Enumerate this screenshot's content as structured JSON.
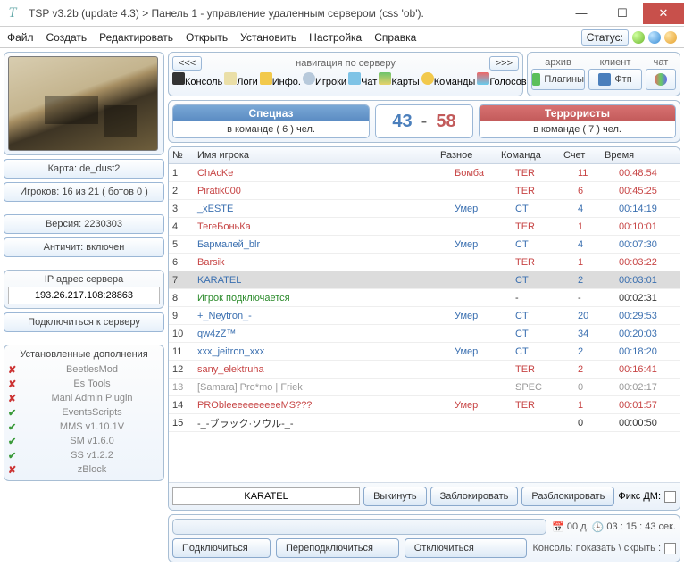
{
  "window": {
    "title": "TSP v3.2b (update 4.3) > Панель 1 - управление удаленным сервером (css 'ob')."
  },
  "menu": {
    "file": "Файл",
    "create": "Создать",
    "edit": "Редактировать",
    "open": "Открыть",
    "install": "Установить",
    "settings": "Настройка",
    "help": "Справка",
    "status_label": "Статус:"
  },
  "nav": {
    "title": "навигация по серверу",
    "prev": "<<<",
    "next": ">>>",
    "items": {
      "console": "Консоль",
      "logs": "Логи",
      "info": "Инфо.",
      "players": "Игроки",
      "chat": "Чат",
      "maps": "Карты",
      "teams": "Команды",
      "voting": "Голосование"
    }
  },
  "topright": {
    "archive": {
      "head": "архив",
      "label": "Плагины"
    },
    "client": {
      "head": "клиент",
      "label": "Фтп"
    },
    "chat": {
      "head": "чат",
      "label": ""
    }
  },
  "left": {
    "map_label": "Карта: de_dust2",
    "players_label": "Игроков: 16 из 21 ( ботов 0 )",
    "version_label": "Версия: 2230303",
    "anticheat_label": "Античит: включен",
    "ip_head": "IP адрес сервера",
    "ip_value": "193.26.217.108:28863",
    "connect_btn": "Подключиться к серверу",
    "addons_head": "Установленные дополнения",
    "addons": [
      {
        "ok": false,
        "name": "BeetlesMod"
      },
      {
        "ok": false,
        "name": "Es Tools"
      },
      {
        "ok": false,
        "name": "Mani Admin Plugin"
      },
      {
        "ok": true,
        "name": "EventsScripts"
      },
      {
        "ok": true,
        "name": "MMS v1.10.1V"
      },
      {
        "ok": true,
        "name": "SM v1.6.0"
      },
      {
        "ok": true,
        "name": "SS v1.2.2"
      },
      {
        "ok": false,
        "name": "zBlock"
      }
    ]
  },
  "teams": {
    "ct": {
      "title": "Спецназ",
      "sub": "в команде ( 6 ) чел.",
      "score": "43"
    },
    "t": {
      "title": "Террористы",
      "sub": "в команде ( 7 ) чел.",
      "score": "58"
    },
    "dash": "-"
  },
  "table": {
    "headers": {
      "n": "№",
      "name": "Имя игрока",
      "misc": "Разное",
      "team": "Команда",
      "score": "Счет",
      "time": "Время"
    },
    "rows": [
      {
        "n": "1",
        "name": "ChAcKe",
        "misc": "Бомба",
        "team": "TER",
        "score": "11",
        "time": "00:48:54",
        "cls": "teamTER"
      },
      {
        "n": "2",
        "name": "Piratik000",
        "misc": "",
        "team": "TER",
        "score": "6",
        "time": "00:45:25",
        "cls": "teamTER"
      },
      {
        "n": "3",
        "name": "_xESTE",
        "misc": "Умер",
        "team": "CT",
        "score": "4",
        "time": "00:14:19",
        "cls": "teamCT"
      },
      {
        "n": "4",
        "name": "ТегеБоньКа",
        "misc": "",
        "team": "TER",
        "score": "1",
        "time": "00:10:01",
        "cls": "teamTER"
      },
      {
        "n": "5",
        "name": "Бармалей_blr",
        "misc": "Умер",
        "team": "CT",
        "score": "4",
        "time": "00:07:30",
        "cls": "teamCT"
      },
      {
        "n": "6",
        "name": "Barsik",
        "misc": "",
        "team": "TER",
        "score": "1",
        "time": "00:03:22",
        "cls": "teamTER"
      },
      {
        "n": "7",
        "name": "KARATEL",
        "misc": "",
        "team": "CT",
        "score": "2",
        "time": "00:03:01",
        "cls": "teamCT",
        "sel": true
      },
      {
        "n": "8",
        "name": "Игрок подключается",
        "misc": "",
        "team": "-",
        "score": "-",
        "time": "00:02:31",
        "cls": "teamNONE connecting"
      },
      {
        "n": "9",
        "name": "+_Neytron_-",
        "misc": "Умер",
        "team": "CT",
        "score": "20",
        "time": "00:29:53",
        "cls": "teamCT"
      },
      {
        "n": "10",
        "name": "qw4zZ™",
        "misc": "",
        "team": "CT",
        "score": "34",
        "time": "00:20:03",
        "cls": "teamCT"
      },
      {
        "n": "11",
        "name": "xxx_jeitron_xxx",
        "misc": "Умер",
        "team": "CT",
        "score": "2",
        "time": "00:18:20",
        "cls": "teamCT"
      },
      {
        "n": "12",
        "name": "sany_elektruha",
        "misc": "",
        "team": "TER",
        "score": "2",
        "time": "00:16:41",
        "cls": "teamTER"
      },
      {
        "n": "13",
        "name": "[Samara] Pro*mo | Friek",
        "misc": "",
        "team": "SPEC",
        "score": "0",
        "time": "00:02:17",
        "cls": "teamSPEC"
      },
      {
        "n": "14",
        "name": "PRObleeeeeeeeeeMS???",
        "misc": "Умер",
        "team": "TER",
        "score": "1",
        "time": "00:01:57",
        "cls": "teamTER"
      },
      {
        "n": "15",
        "name": "-_-ブラック·ソウル-_-",
        "misc": "",
        "team": "",
        "score": "0",
        "time": "00:00:50",
        "cls": "teamNONE"
      }
    ]
  },
  "actions": {
    "selected": "KARATEL",
    "kick": "Выкинуть",
    "ban": "Заблокировать",
    "unban": "Разблокировать",
    "fixdm": "Фикс ДМ:"
  },
  "bottom": {
    "uptime_days": "00 д.",
    "uptime_clock": "03 : 15 : 43 сек.",
    "connect": "Подключиться",
    "reconnect": "Переподключиться",
    "disconnect": "Отключиться",
    "console_toggle": "Консоль: показать \\ скрыть :"
  }
}
